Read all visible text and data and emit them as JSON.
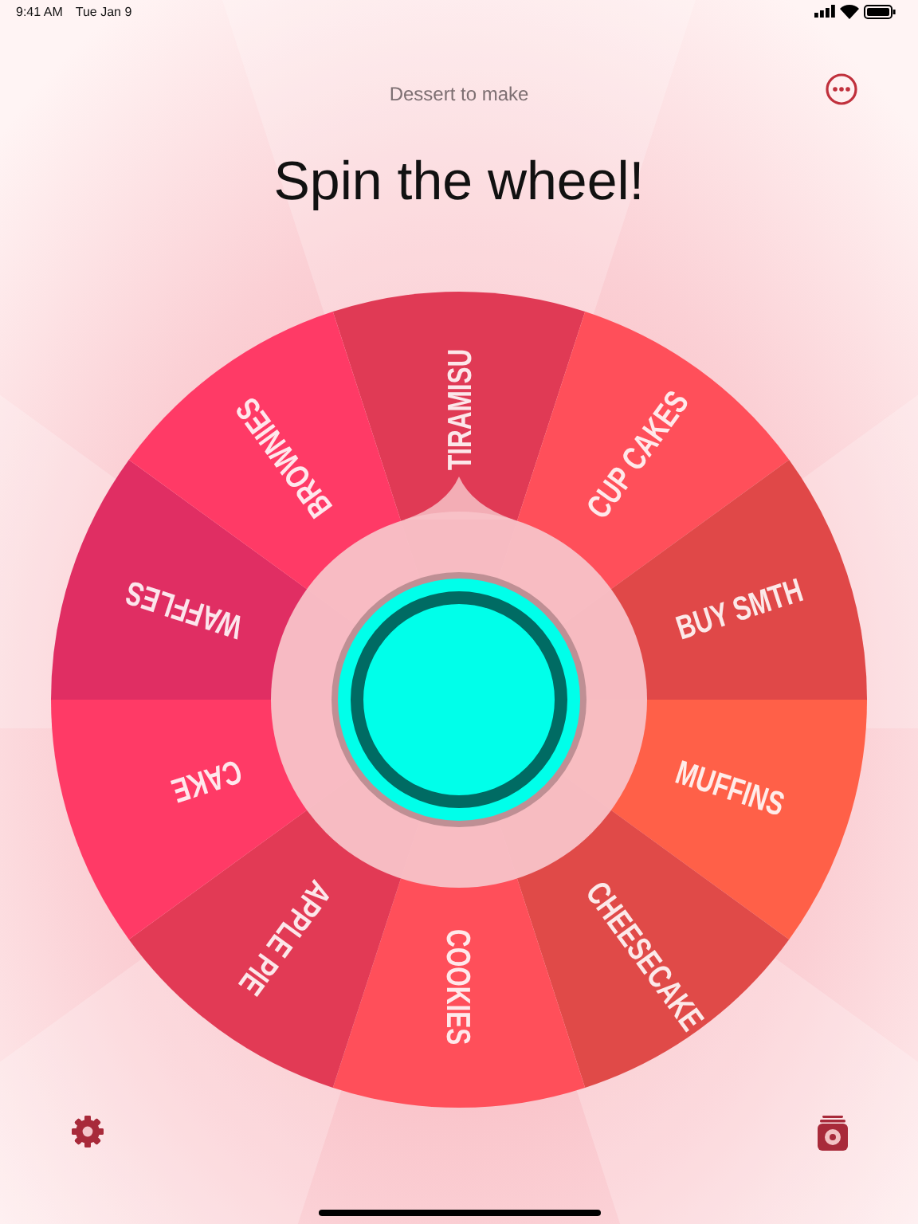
{
  "status_bar": {
    "time": "9:41 AM",
    "date": "Tue Jan 9"
  },
  "subtitle": "Dessert to make",
  "title": "Spin the wheel!",
  "wheel": {
    "segments": [
      {
        "label": "TIRAMISU",
        "color": "#e03a55"
      },
      {
        "label": "CUP CAKES",
        "color": "#ff4f5a"
      },
      {
        "label": "BUY SMTH",
        "color": "#e04848"
      },
      {
        "label": "MUFFINS",
        "color": "#ff6048"
      },
      {
        "label": "CHEESECAKE",
        "color": "#e04a48"
      },
      {
        "label": "COOKIES",
        "color": "#ff4f5a"
      },
      {
        "label": "APPLE PIE",
        "color": "#e23a55"
      },
      {
        "label": "CAKE",
        "color": "#ff3a66"
      },
      {
        "label": "WAFFLES",
        "color": "#e02e63"
      },
      {
        "label": "BROWNIES",
        "color": "#ff3a66"
      }
    ]
  }
}
